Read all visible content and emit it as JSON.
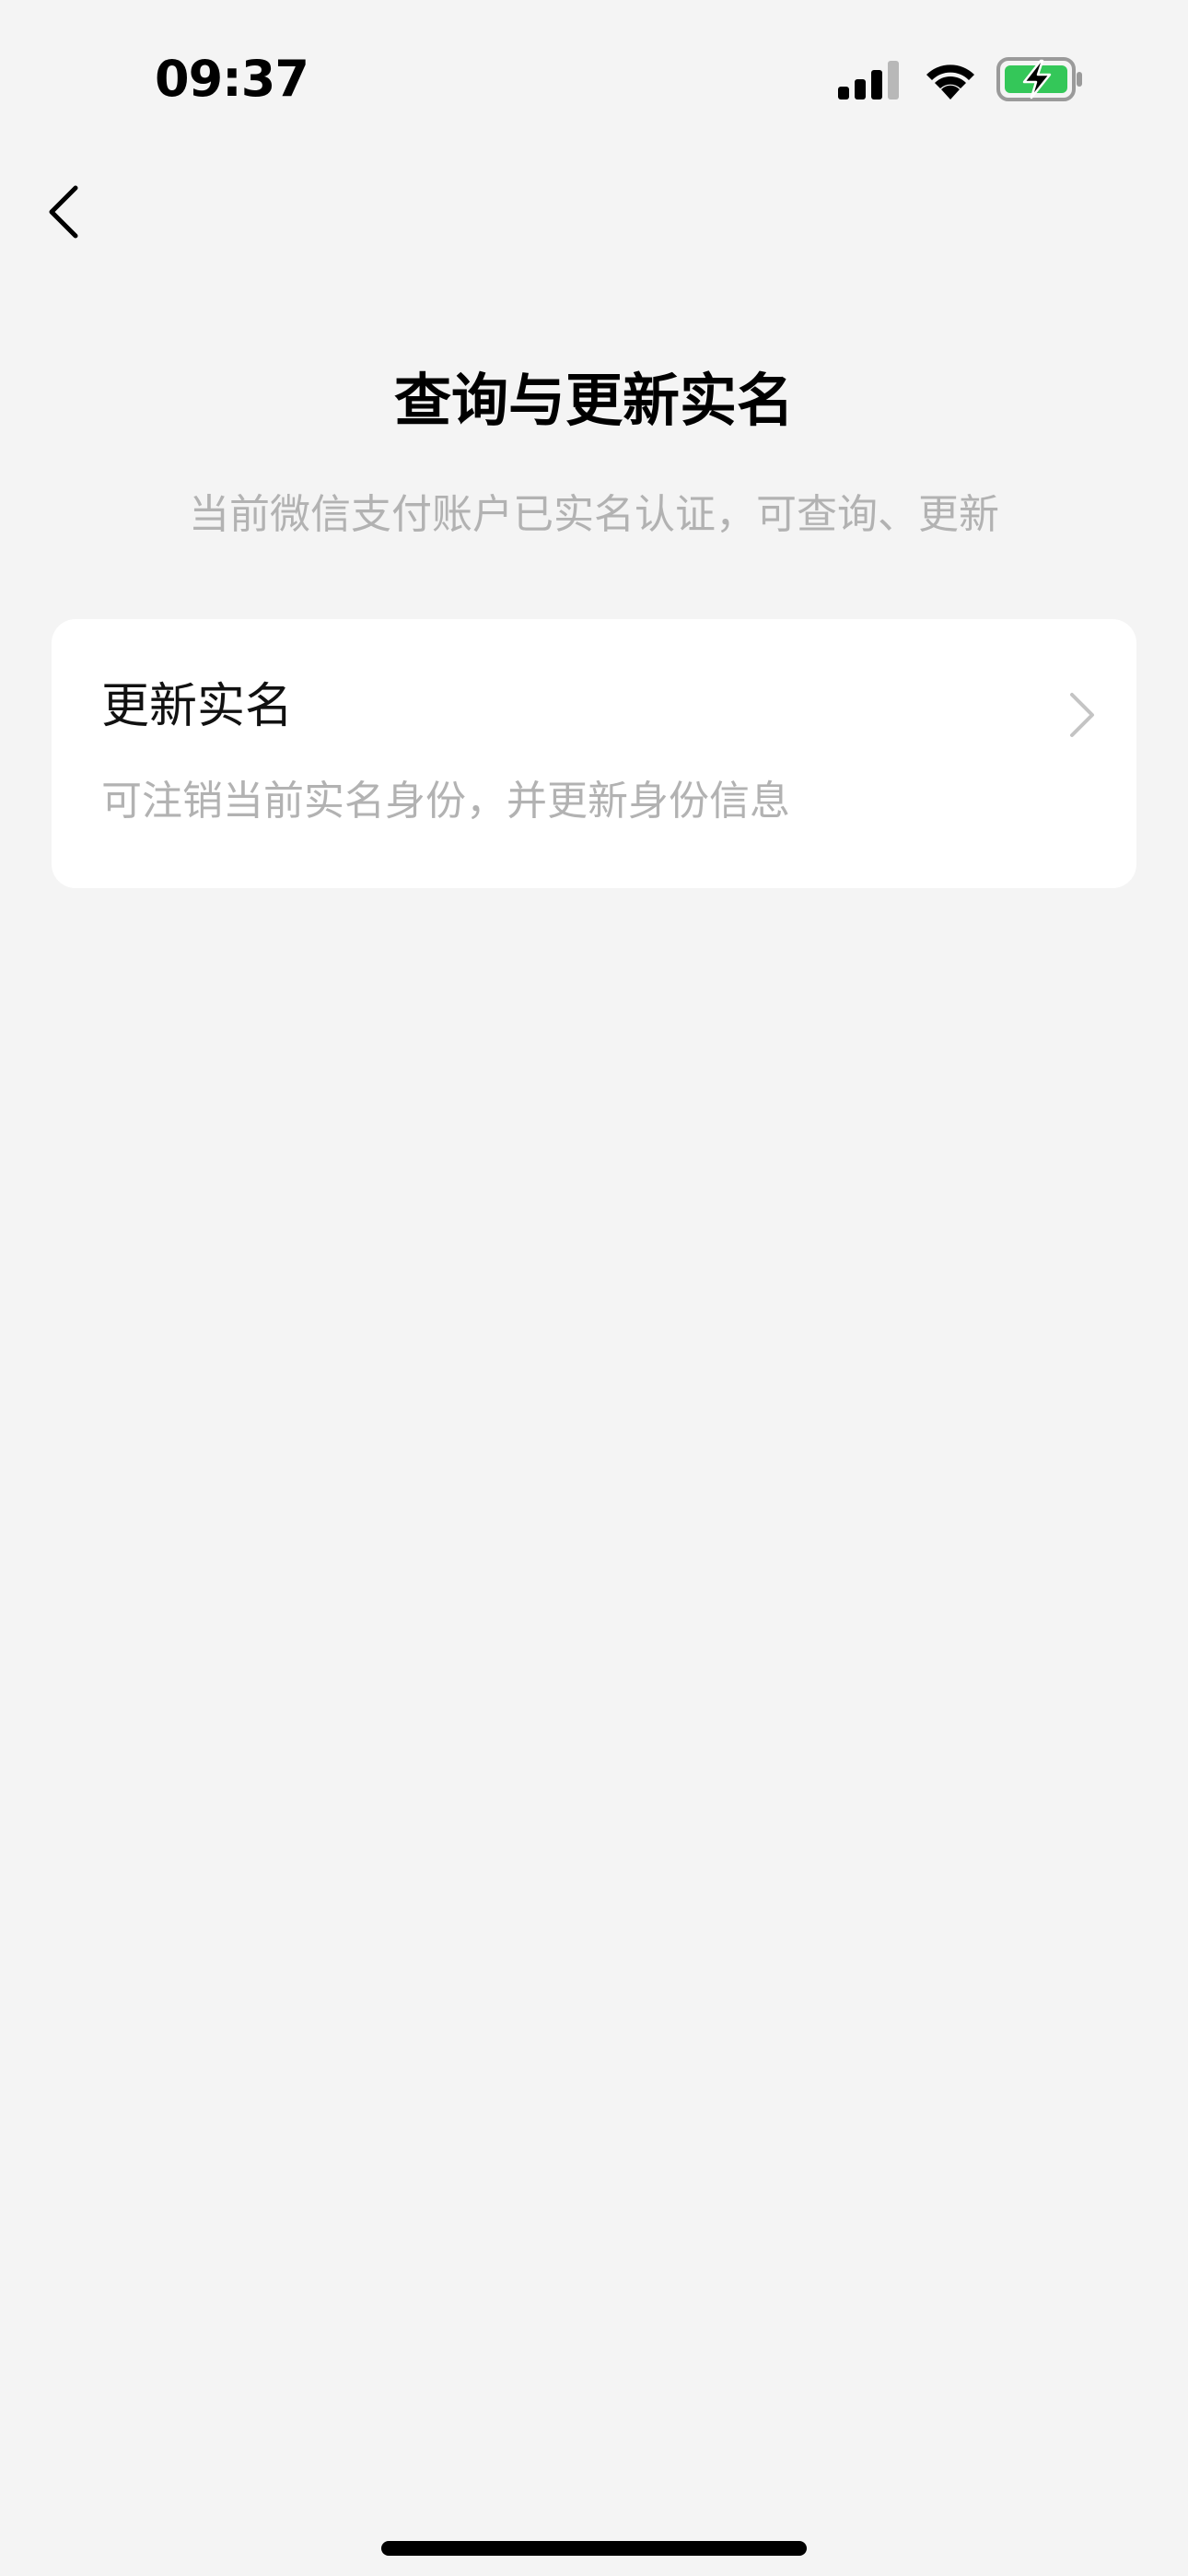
{
  "status_bar": {
    "time": "09:37",
    "icons": [
      "cellular-signal-icon",
      "wifi-icon",
      "battery-charging-icon"
    ],
    "battery_color": "#34c759"
  },
  "nav": {
    "back_icon": "chevron-left-icon"
  },
  "header": {
    "title": "查询与更新实名",
    "subtitle": "当前微信支付账户已实名认证，可查询、更新"
  },
  "option_card": {
    "title": "更新实名",
    "description": "可注销当前实名身份，并更新身份信息",
    "chevron_icon": "chevron-right-icon"
  },
  "colors": {
    "background": "#f4f4f4",
    "card": "#ffffff",
    "secondary_text": "#b2b2b2"
  }
}
